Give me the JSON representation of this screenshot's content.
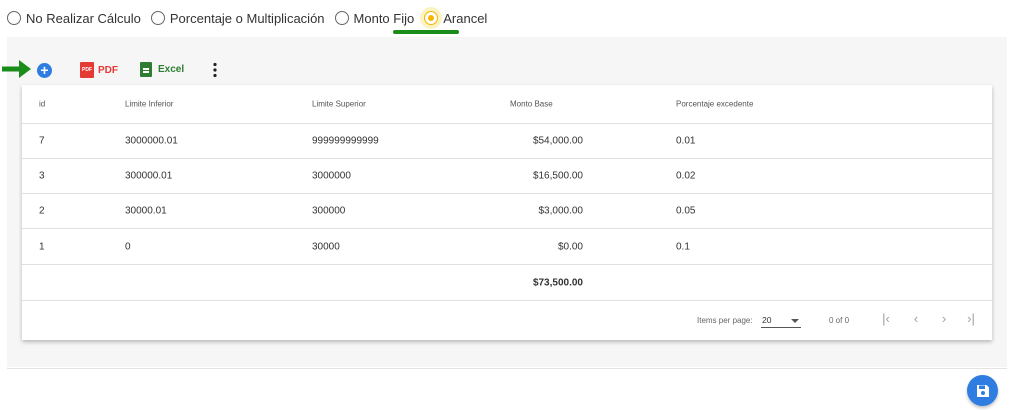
{
  "calc_options": [
    {
      "label": "No Realizar Cálculo",
      "selected": false
    },
    {
      "label": "Porcentaje o Multiplicación",
      "selected": false
    },
    {
      "label": "Monto Fijo",
      "selected": false
    },
    {
      "label": "Arancel",
      "selected": true
    }
  ],
  "toolbar": {
    "pdf_label": "PDF",
    "pdf_icon_text": "PDF",
    "excel_label": "Excel",
    "more": "⋮",
    "add": "+"
  },
  "table": {
    "columns": {
      "id": "id",
      "inferior": "Limite Inferior",
      "superior": "Limite Superior",
      "base": "Monto Base",
      "pct": "Porcentaje excedente"
    },
    "rows": [
      {
        "id": "7",
        "inferior": "3000000.01",
        "superior": "999999999999",
        "base": "$54,000.00",
        "pct": "0.01"
      },
      {
        "id": "3",
        "inferior": "300000.01",
        "superior": "3000000",
        "base": "$16,500.00",
        "pct": "0.02"
      },
      {
        "id": "2",
        "inferior": "30000.01",
        "superior": "300000",
        "base": "$3,000.00",
        "pct": "0.05"
      },
      {
        "id": "1",
        "inferior": "0",
        "superior": "30000",
        "base": "$0.00",
        "pct": "0.1"
      }
    ],
    "total_base": "$73,500.00"
  },
  "paginator": {
    "items_per_page_label": "Items per page:",
    "page_size": "20",
    "range": "0 of 0",
    "first": "|‹",
    "prev": "‹",
    "next": "›",
    "last": "›|"
  },
  "colors": {
    "accent": "#2f7de1",
    "selected_radio": "#f5b400",
    "highlight_green": "#1a8c1a",
    "pdf_red": "#e53935",
    "excel_green": "#2e7d32"
  }
}
